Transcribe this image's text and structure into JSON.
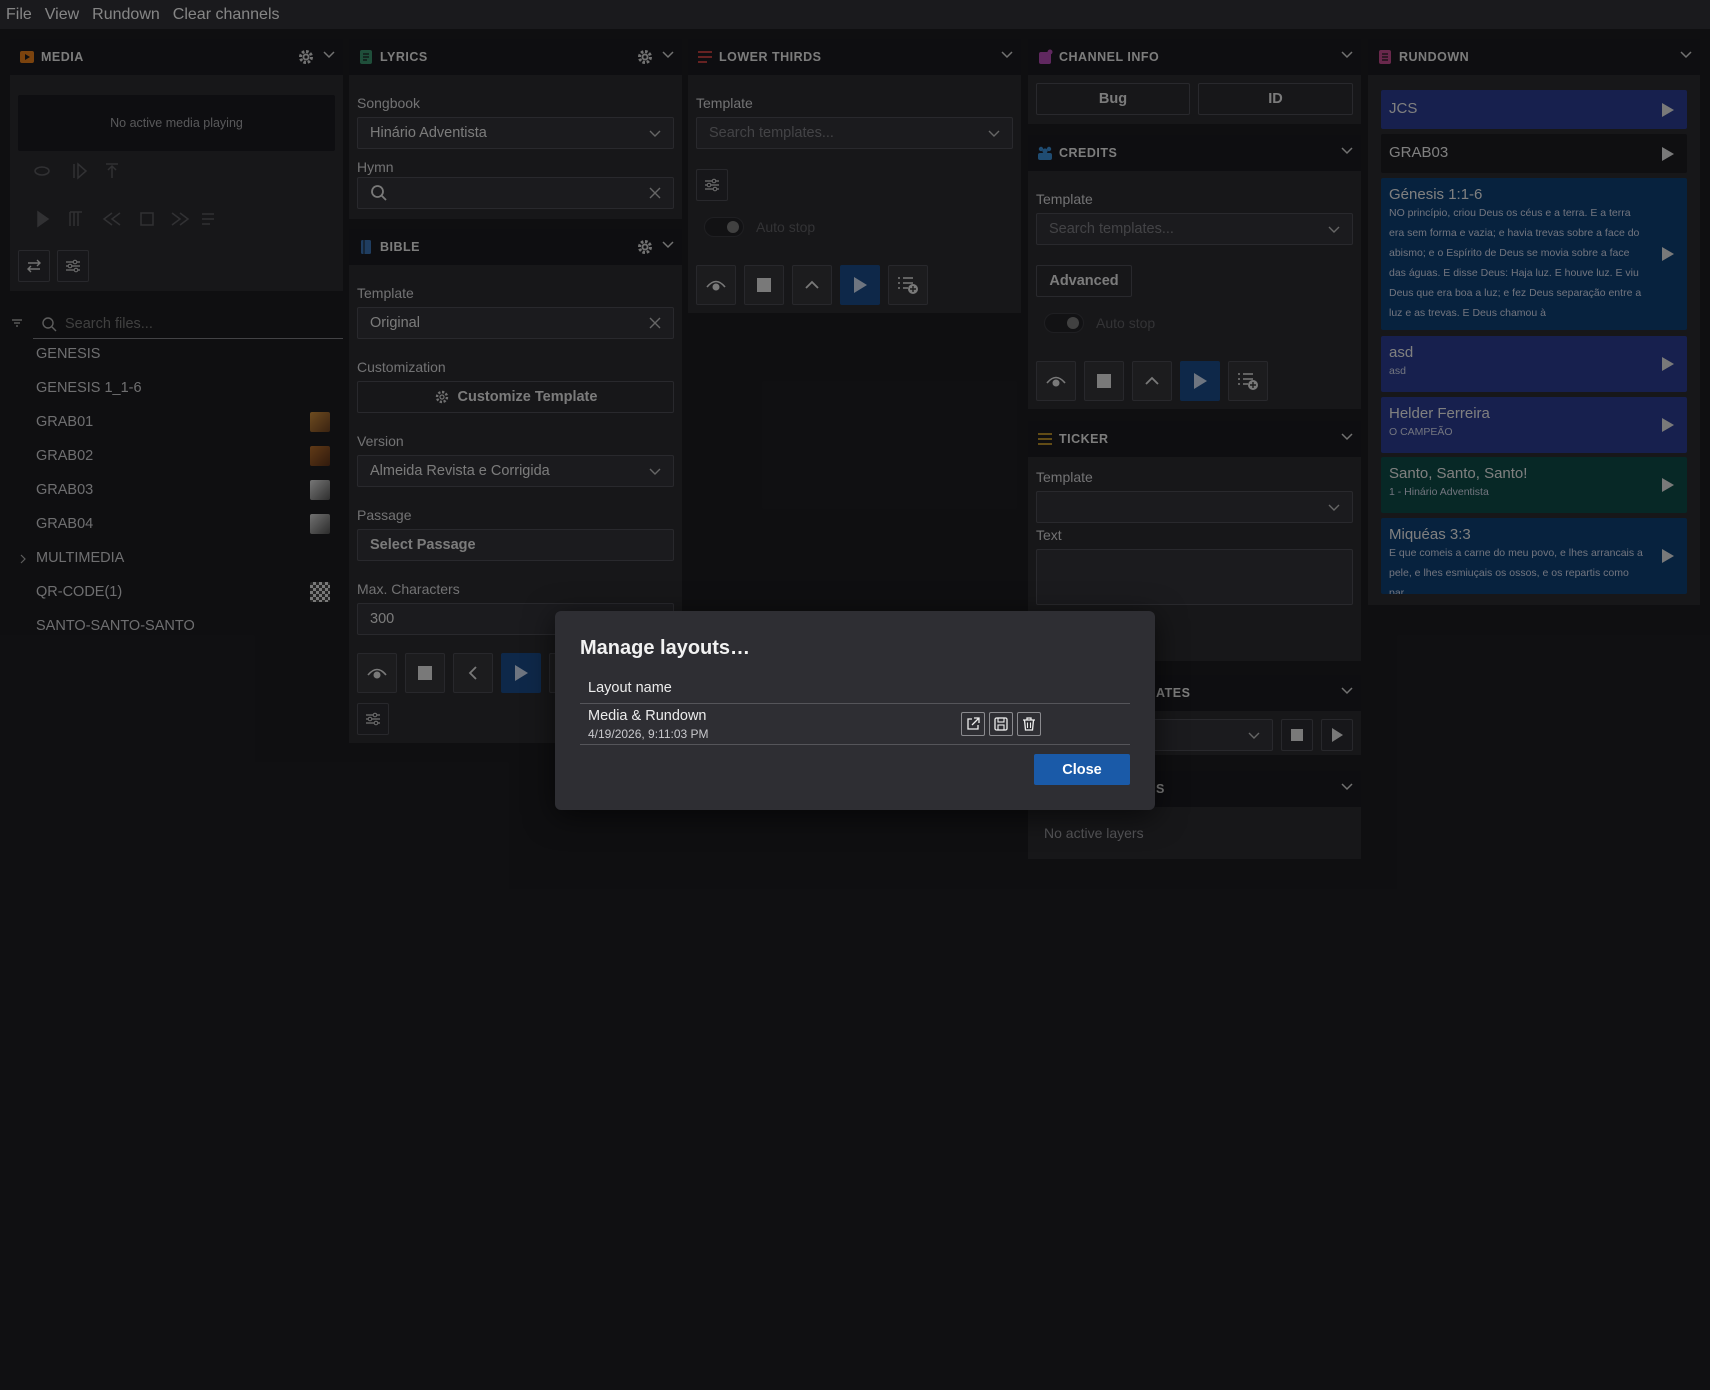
{
  "menu": {
    "file": "File",
    "view": "View",
    "rundown": "Rundown",
    "clear": "Clear channels"
  },
  "media": {
    "title": "MEDIA",
    "no_media": "No active media playing",
    "search_placeholder": "Search files...",
    "files": [
      "GENESIS",
      "GENESIS 1_1-6",
      "GRAB01",
      "GRAB02",
      "GRAB03",
      "GRAB04",
      "MULTIMEDIA",
      "QR-CODE(1)",
      "SANTO-SANTO-SANTO"
    ]
  },
  "lyrics": {
    "title": "LYRICS",
    "songbook_label": "Songbook",
    "songbook_value": "Hinário Adventista",
    "hymn_label": "Hymn",
    "hymn_value": ""
  },
  "bible": {
    "title": "BIBLE",
    "template_label": "Template",
    "template_value": "Original",
    "customization_label": "Customization",
    "customize_button": "Customize Template",
    "version_label": "Version",
    "version_value": "Almeida Revista e Corrigida",
    "passage_label": "Passage",
    "passage_button": "Select Passage",
    "maxchars_label": "Max. Characters",
    "maxchars_value": "300"
  },
  "lower_thirds": {
    "title": "LOWER THIRDS",
    "template_label": "Template",
    "template_placeholder": "Search templates...",
    "auto_stop": "Auto stop"
  },
  "channel_info": {
    "title": "CHANNEL INFO",
    "bug_button": "Bug",
    "id_button": "ID"
  },
  "credits": {
    "title": "CREDITS",
    "template_label": "Template",
    "template_placeholder": "Search templates...",
    "advanced_button": "Advanced",
    "auto_stop": "Auto stop"
  },
  "ticker": {
    "title": "TICKER",
    "template_label": "Template",
    "text_label": "Text",
    "text_value": ""
  },
  "hidden_panels": {
    "templates_title_fragment": "ATES",
    "layers_title_fragment": "S",
    "no_active_layers": "No active layers"
  },
  "rundown": {
    "title": "RUNDOWN",
    "items": [
      {
        "title": "JCS",
        "subtitle": "",
        "color": "#2a3b8f"
      },
      {
        "title": "GRAB03",
        "subtitle": "",
        "color": "#1c1c20"
      },
      {
        "title": "Génesis 1:1-6",
        "subtitle": "NO princípio, criou Deus os céus e a terra. E a terra era sem forma e vazia; e havia trevas sobre a face do abismo; e o Espírito de Deus se movia sobre a face das águas. E disse Deus: Haja luz. E houve luz. E viu Deus que era boa a luz; e fez Deus separação entre a luz e as trevas. E Deus chamou à",
        "color": "#0d3f72"
      },
      {
        "title": "asd",
        "subtitle": "asd",
        "color": "#2a3b8f"
      },
      {
        "title": "Helder Ferreira",
        "subtitle": "O CAMPEÃO",
        "color": "#2a3b8f"
      },
      {
        "title": "Santo, Santo, Santo!",
        "subtitle": "1 - Hinário Adventista",
        "color": "#0d4a46"
      },
      {
        "title": "Miquéas 3:3",
        "subtitle": "E que comeis a carne do meu povo, e lhes arrancais a pele, e lhes esmiuçais os ossos, e os repartis como par…",
        "color": "#0d3f72"
      }
    ]
  },
  "modal": {
    "title": "Manage layouts…",
    "column_header": "Layout name",
    "layouts": [
      {
        "name": "Media & Rundown",
        "date": "4/19/2026, 9:11:03 PM"
      }
    ],
    "close_button": "Close"
  },
  "colors": {
    "accent_blue": "#1a5aa8",
    "media_icon": "#e07b1a",
    "lyrics_icon": "#3a8f6a",
    "bible_icon": "#3a6fb0",
    "lower_thirds_icon": "#d04444",
    "channel_icon": "#b04ab0",
    "credits_icon": "#3a8ad0",
    "ticker_icon": "#c89a2a",
    "rundown_icon": "#c04a8a"
  }
}
